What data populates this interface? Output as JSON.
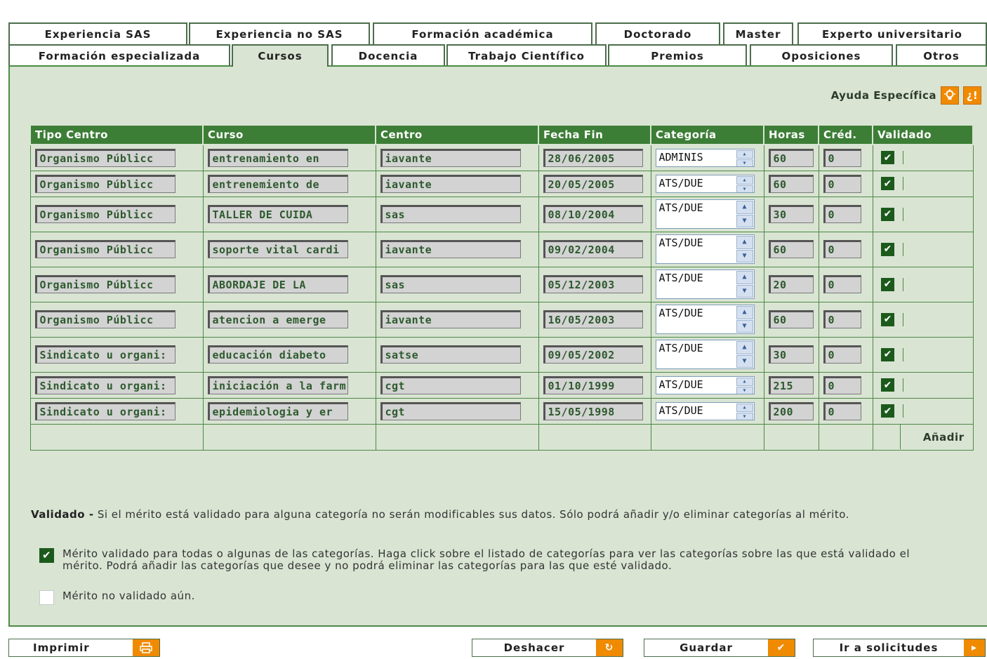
{
  "tabs_row1": [
    "Experiencia SAS",
    "Experiencia no SAS",
    "Formación académica",
    "Doctorado",
    "Master",
    "Experto universitario"
  ],
  "tabs_row2": [
    "Formación especializada",
    "Cursos",
    "Docencia",
    "Trabajo Científico",
    "Premios",
    "Oposiciones",
    "Otros"
  ],
  "active_tab": "Cursos",
  "help": {
    "label": "Ayuda Específica",
    "icon1": "lightbulb-icon",
    "icon2": "info-icon",
    "icon2_text": "¿!"
  },
  "table": {
    "headers": [
      "Tipo Centro",
      "Curso",
      "Centro",
      "Fecha Fin",
      "Categoría",
      "Horas",
      "Créd.",
      "Validado"
    ],
    "rows": [
      {
        "tipo": "Organismo Públicc",
        "curso": "entrenamiento en",
        "centro": "iavante",
        "fecha": "28/06/2005",
        "categoria": "ADMINIS",
        "horas": "60",
        "cred": "0",
        "tall": false
      },
      {
        "tipo": "Organismo Públicc",
        "curso": "entrenemiento de",
        "centro": "iavante",
        "fecha": "20/05/2005",
        "categoria": "ATS/DUE",
        "horas": "60",
        "cred": "0",
        "tall": false
      },
      {
        "tipo": "Organismo Públicc",
        "curso": "TALLER DE CUIDA",
        "centro": "sas",
        "fecha": "08/10/2004",
        "categoria": "ATS/DUE",
        "horas": "30",
        "cred": "0",
        "tall": true
      },
      {
        "tipo": "Organismo Públicc",
        "curso": "soporte vital cardi",
        "centro": "iavante",
        "fecha": "09/02/2004",
        "categoria": "ATS/DUE",
        "horas": "60",
        "cred": "0",
        "tall": true
      },
      {
        "tipo": "Organismo Públicc",
        "curso": "ABORDAJE DE LA",
        "centro": "sas",
        "fecha": "05/12/2003",
        "categoria": "ATS/DUE",
        "horas": "20",
        "cred": "0",
        "tall": true
      },
      {
        "tipo": "Organismo Públicc",
        "curso": "atencion a emerge",
        "centro": "iavante",
        "fecha": "16/05/2003",
        "categoria": "ATS/DUE",
        "horas": "60",
        "cred": "0",
        "tall": true
      },
      {
        "tipo": "Sindicato u organi:",
        "curso": "educación diabeto",
        "centro": "satse",
        "fecha": "09/05/2002",
        "categoria": "ATS/DUE",
        "horas": "30",
        "cred": "0",
        "tall": true
      },
      {
        "tipo": "Sindicato u organi:",
        "curso": "iniciación a la farm",
        "centro": "cgt",
        "fecha": "01/10/1999",
        "categoria": "ATS/DUE",
        "horas": "215",
        "cred": "0",
        "tall": false
      },
      {
        "tipo": "Sindicato u organi:",
        "curso": "epidemiologia y er",
        "centro": "cgt",
        "fecha": "15/05/1998",
        "categoria": "ATS/DUE",
        "horas": "200",
        "cred": "0",
        "tall": false
      }
    ],
    "add_label": "Añadir"
  },
  "note": {
    "bold": "Validado -",
    "text": " Si el mérito está validado para alguna categoría no serán modificables sus datos. Sólo podrá añadir y/o eliminar categorías al mérito."
  },
  "legend": {
    "validated": "Mérito validado para todas o algunas de las categorías. Haga click sobre el listado de categorías para ver las categorías sobre las que está validado el mérito. Podrá añadir las categorías que desee y no podrá eliminar las categorías para las que esté validado.",
    "not_validated": "Mérito no validado aún."
  },
  "buttons": {
    "print": "Imprimir",
    "undo": "Deshacer",
    "save": "Guardar",
    "go": "Ir a solicitudes"
  },
  "colors": {
    "accent": "#3d7e37",
    "panel": "#d9e4d3",
    "orange": "#f08a00"
  }
}
